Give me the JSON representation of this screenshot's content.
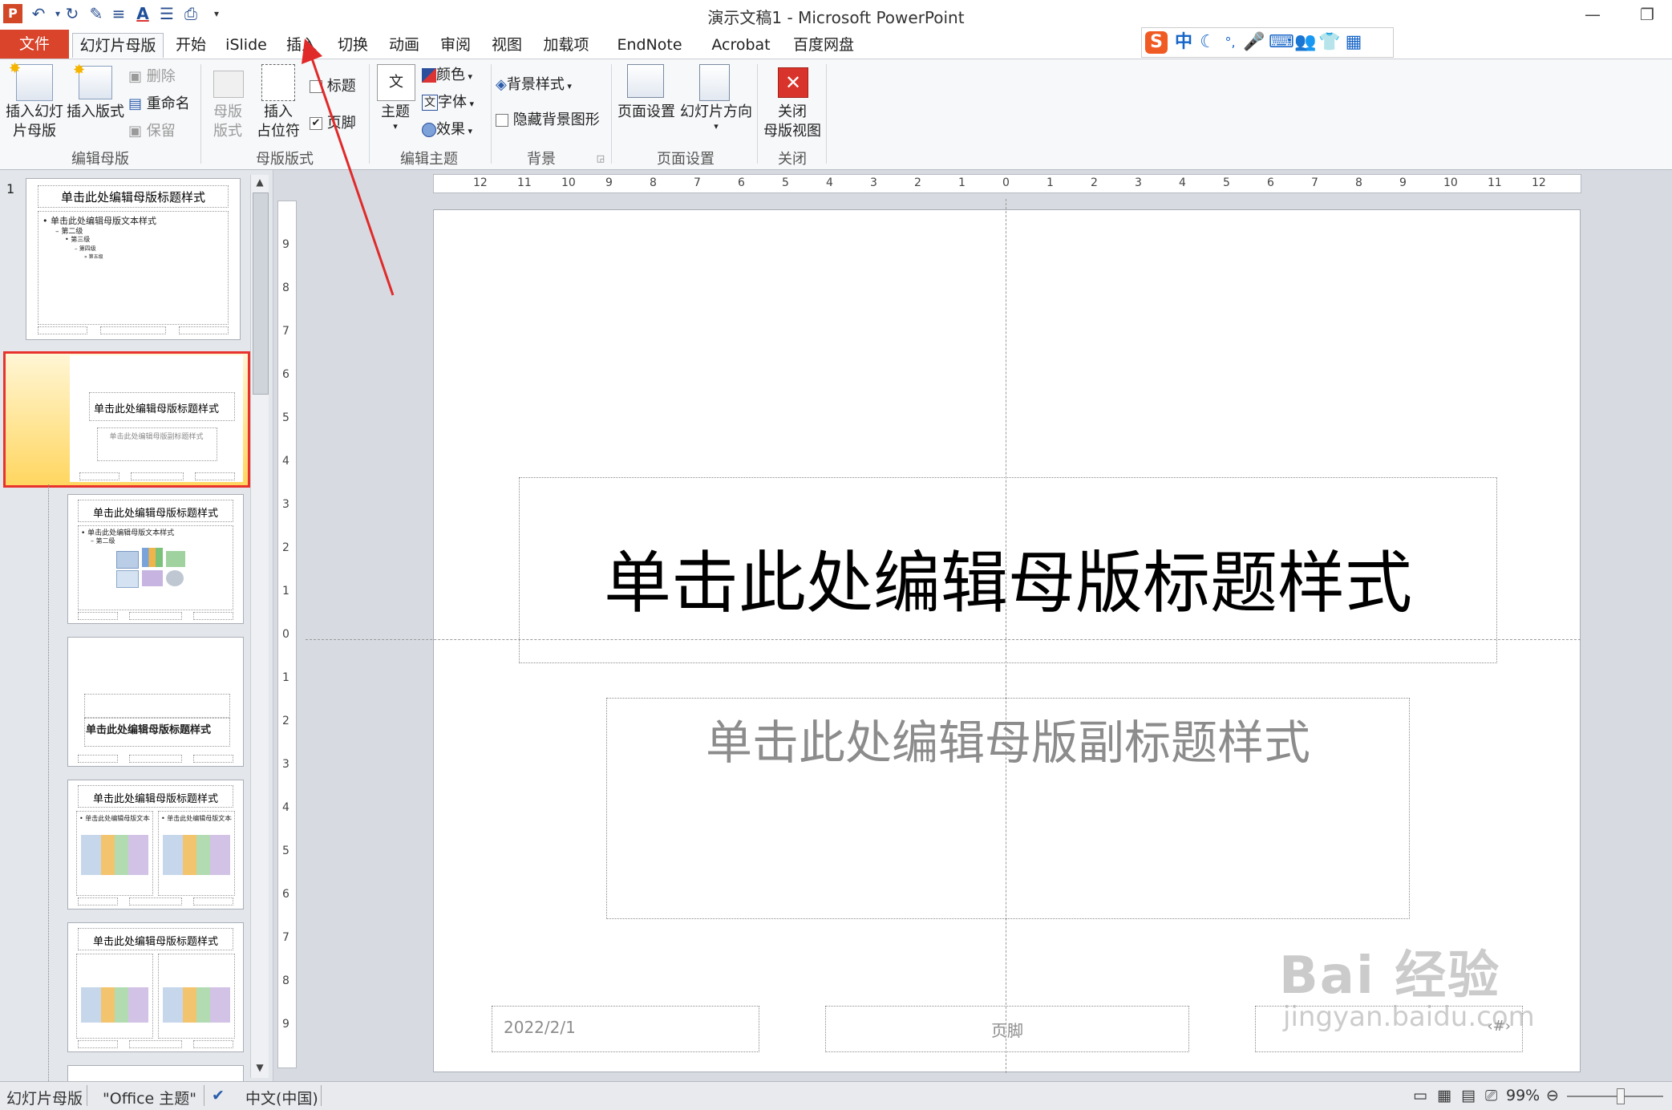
{
  "window": {
    "title": "演示文稿1 - Microsoft PowerPoint"
  },
  "tabs": {
    "file": "文件",
    "active": "幻灯片母版",
    "items": [
      "开始",
      "iSlide",
      "插入",
      "切换",
      "动画",
      "审阅",
      "视图",
      "加载项",
      "EndNote X9",
      "Acrobat",
      "百度网盘"
    ]
  },
  "ime": {
    "mode": "中",
    "punct": "°,"
  },
  "ribbon": {
    "edit_master": {
      "label": "编辑母版",
      "insert_slide_master": [
        "插入幻灯",
        "片母版"
      ],
      "insert_layout": "插入版式",
      "delete": "删除",
      "rename": "重命名",
      "preserve": "保留"
    },
    "master_layout": {
      "label": "母版版式",
      "master_layout_btn": [
        "母版",
        "版式"
      ],
      "insert_placeholder": [
        "插入",
        "占位符"
      ],
      "title_chk": "标题",
      "footer_chk": "页脚"
    },
    "edit_theme": {
      "label": "编辑主题",
      "themes": "主题",
      "colors": "颜色",
      "fonts": "字体",
      "effects": "效果"
    },
    "background": {
      "label": "背景",
      "bg_styles": "背景样式",
      "hide_bg": "隐藏背景图形"
    },
    "page_setup": {
      "label": "页面设置",
      "page_setup_btn": "页面设置",
      "orientation": "幻灯片方向"
    },
    "close": {
      "label": "关闭",
      "close_btn": [
        "关闭",
        "母版视图"
      ]
    }
  },
  "thumbnails": {
    "slide_number": "1",
    "master_title": "单击此处编辑母版标题样式",
    "master_body": "• 单击此处编辑母版文本样式",
    "level2": "– 第二级",
    "level3": "• 第三级",
    "level4": "– 第四级",
    "level5": "» 第五级",
    "subtitle_small": "单击此处编辑母版副标题样式",
    "col_text": "• 单击此处编辑母版文本样式"
  },
  "ruler": {
    "h": [
      "12",
      "11",
      "10",
      "9",
      "8",
      "7",
      "6",
      "5",
      "4",
      "3",
      "2",
      "1",
      "0",
      "1",
      "2",
      "3",
      "4",
      "5",
      "6",
      "7",
      "8",
      "9",
      "10",
      "11",
      "12"
    ],
    "v": [
      "9",
      "8",
      "7",
      "6",
      "5",
      "4",
      "3",
      "2",
      "1",
      "0",
      "1",
      "2",
      "3",
      "4",
      "5",
      "6",
      "7",
      "8",
      "9"
    ]
  },
  "slide": {
    "title": "单击此处编辑母版标题样式",
    "subtitle": "单击此处编辑母版副标题样式",
    "date": "2022/2/1",
    "footer": "页脚",
    "number": "‹#›"
  },
  "status": {
    "view": "幻灯片母版",
    "theme": "\"Office 主题\"",
    "lang": "中文(中国)",
    "zoom": "99%"
  },
  "watermark": {
    "main": "Bai 经验",
    "url": "jingyan.baidu.com"
  },
  "colors": {
    "file_tab": "#d9442b",
    "selection": "#e8322d",
    "accent": "#2a5caa"
  }
}
